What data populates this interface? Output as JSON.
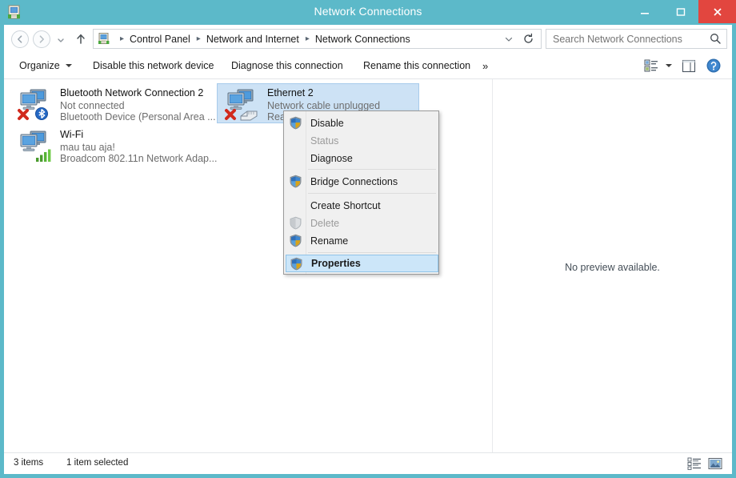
{
  "window": {
    "title": "Network Connections",
    "icon": "network-connections-icon",
    "controls": {
      "minimize": "minimize-button",
      "maximize": "maximize-button",
      "close": "close-button"
    },
    "accent_color": "#5cb9c9",
    "close_color": "#e2463f",
    "selection_color": "#cde2f5"
  },
  "nav": {
    "back": "back-button",
    "forward": "forward-button",
    "recent": "recent-locations-button",
    "up": "up-button",
    "address_icon": "control-panel-icon",
    "breadcrumbs": [
      {
        "label": "Control Panel"
      },
      {
        "label": "Network and Internet"
      },
      {
        "label": "Network Connections"
      }
    ],
    "separator": "▸",
    "dropdown": "address-dropdown-icon",
    "refresh": "refresh-icon"
  },
  "search": {
    "placeholder": "Search Network Connections",
    "value": "",
    "icon": "search-icon"
  },
  "toolbar": {
    "organize": "Organize",
    "disable_device": "Disable this network device",
    "diagnose": "Diagnose this connection",
    "rename": "Rename this connection",
    "overflow": "»",
    "view_options": "change-view-icon",
    "preview_pane": "preview-pane-icon",
    "help": "help-icon"
  },
  "connections": [
    {
      "name": "Bluetooth Network Connection 2",
      "status": "Not connected",
      "device": "Bluetooth Device (Personal Area ...",
      "icon": "network-adapter-icon",
      "badge": "bluetooth-badge-icon",
      "error": true,
      "selected": false
    },
    {
      "name": "Wi-Fi",
      "status": "mau tau aja!",
      "device": "Broadcom 802.11n Network Adap...",
      "icon": "network-adapter-icon",
      "badge": "wifi-signal-badge-icon",
      "error": false,
      "selected": false
    },
    {
      "name": "Ethernet 2",
      "status": "Network cable unplugged",
      "device": "Realt",
      "icon": "network-adapter-icon",
      "badge": "ethernet-cable-badge-icon",
      "error": true,
      "selected": true
    }
  ],
  "context_menu": [
    {
      "label": "Disable",
      "icon": "uac-shield-icon",
      "disabled": false,
      "highlighted": false,
      "sep_after": false
    },
    {
      "label": "Status",
      "icon": "",
      "disabled": true,
      "highlighted": false,
      "sep_after": false
    },
    {
      "label": "Diagnose",
      "icon": "",
      "disabled": false,
      "highlighted": false,
      "sep_after": true
    },
    {
      "label": "Bridge Connections",
      "icon": "uac-shield-icon",
      "disabled": false,
      "highlighted": false,
      "sep_after": true
    },
    {
      "label": "Create Shortcut",
      "icon": "",
      "disabled": false,
      "highlighted": false,
      "sep_after": false
    },
    {
      "label": "Delete",
      "icon": "uac-shield-disabled-icon",
      "disabled": true,
      "highlighted": false,
      "sep_after": false
    },
    {
      "label": "Rename",
      "icon": "uac-shield-icon",
      "disabled": false,
      "highlighted": false,
      "sep_after": true
    },
    {
      "label": "Properties",
      "icon": "uac-shield-icon",
      "disabled": false,
      "highlighted": true,
      "sep_after": false
    }
  ],
  "preview": {
    "message": "No preview available."
  },
  "statusbar": {
    "item_count": "3 items",
    "selection": "1 item selected",
    "details_view": "details-view-icon",
    "large_icons_view": "large-icons-view-icon"
  }
}
